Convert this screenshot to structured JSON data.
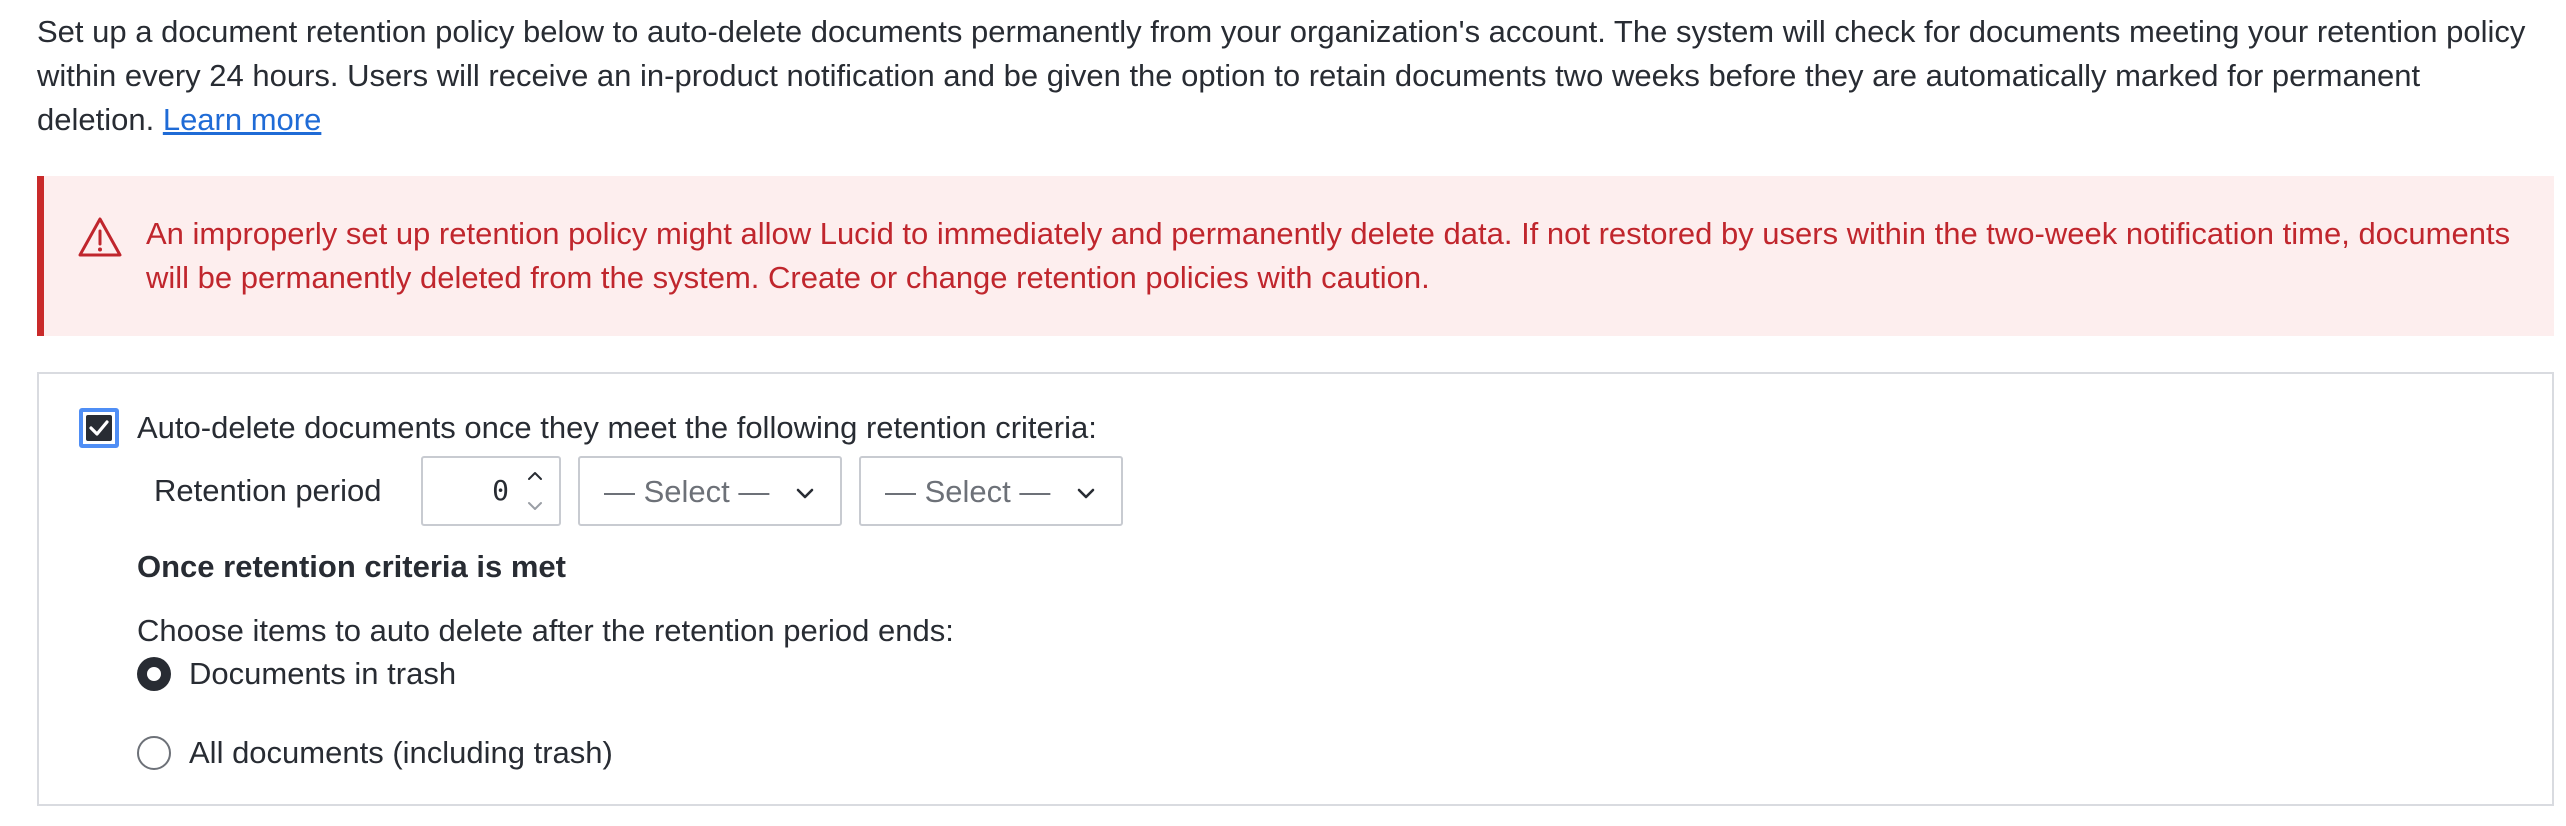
{
  "intro": {
    "text": "Set up a document retention policy below to auto-delete documents permanently from your organization's account. The system will check for documents meeting your retention policy within every 24 hours. Users will receive an in-product notification and be given the option to retain documents two weeks before they are automatically marked for permanent deletion. ",
    "link_label": "Learn more"
  },
  "warning": {
    "icon": "warning-triangle-icon",
    "text": "An improperly set up retention policy might allow Lucid to immediately and permanently delete data. If not restored by users within the two-week notification time, documents will be permanently deleted from the system. Create or change retention policies with caution.",
    "color": "#c0262d",
    "background": "#fdeeee"
  },
  "policy": {
    "auto_delete_checked": true,
    "auto_delete_label": "Auto-delete documents once they meet the following retention criteria:",
    "retention_period_label": "Retention period",
    "retention_value": "0",
    "select_1": "— Select —",
    "select_2": "— Select —",
    "section_title": "Once retention criteria is met",
    "choose_label": "Choose items to auto delete after the retention period ends:",
    "options": [
      {
        "label": "Documents in trash",
        "selected": true
      },
      {
        "label": "All documents (including trash)",
        "selected": false
      }
    ]
  }
}
